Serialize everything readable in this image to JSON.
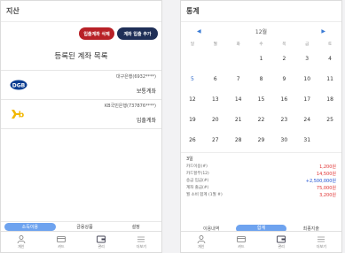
{
  "left": {
    "title": "지산",
    "buttons": {
      "delete_label": "입출계좌 삭제",
      "add_label": "계좌 입출 추가"
    },
    "section_title": "등록된 계좌 목록",
    "accounts": [
      {
        "logo_text": "DGB",
        "name": "대구은행(6932****)",
        "type": "보통계좌",
        "brand_color": "#0b3d91"
      },
      {
        "logo_text": "Kb",
        "name": "KB국민은행(737876****)",
        "type": "입출계좌",
        "brand_color": "#f2b701"
      }
    ],
    "bottom_tabs": [
      "소득이용",
      "금융상품",
      "설정"
    ],
    "nav": [
      "개인",
      "카드",
      "관리",
      "더보기"
    ]
  },
  "right": {
    "title": "통계",
    "month_label": "12월",
    "weekdays": [
      "일",
      "월",
      "화",
      "수",
      "목",
      "금",
      "토"
    ],
    "weeks": [
      [
        "",
        "",
        "",
        "1",
        "2",
        "3",
        "4"
      ],
      [
        "5",
        "6",
        "7",
        "8",
        "9",
        "10",
        "11"
      ],
      [
        "12",
        "13",
        "14",
        "15",
        "16",
        "17",
        "18"
      ],
      [
        "19",
        "20",
        "21",
        "22",
        "23",
        "24",
        "25"
      ],
      [
        "26",
        "27",
        "28",
        "29",
        "30",
        "31",
        ""
      ]
    ],
    "summary_title": "3일",
    "summary": [
      {
        "label": "카드이용(#)",
        "value": "1,200원",
        "color": "#e03131"
      },
      {
        "label": "카드할부(12)",
        "value": "14,500원",
        "color": "#e03131"
      },
      {
        "label": "송금 입금(#)",
        "value": "+2,500,000원",
        "color": "#1c4fd1"
      },
      {
        "label": "계좌 출금(#)",
        "value": "75,000원",
        "color": "#e03131"
      },
      {
        "label": "월 소비 합계 (1월 #)",
        "value": "3,200원",
        "color": "#e03131"
      }
    ],
    "segment": [
      "이용내역",
      "합계",
      "최종지출"
    ],
    "nav": [
      "개인",
      "카드",
      "관리",
      "더보기"
    ]
  }
}
